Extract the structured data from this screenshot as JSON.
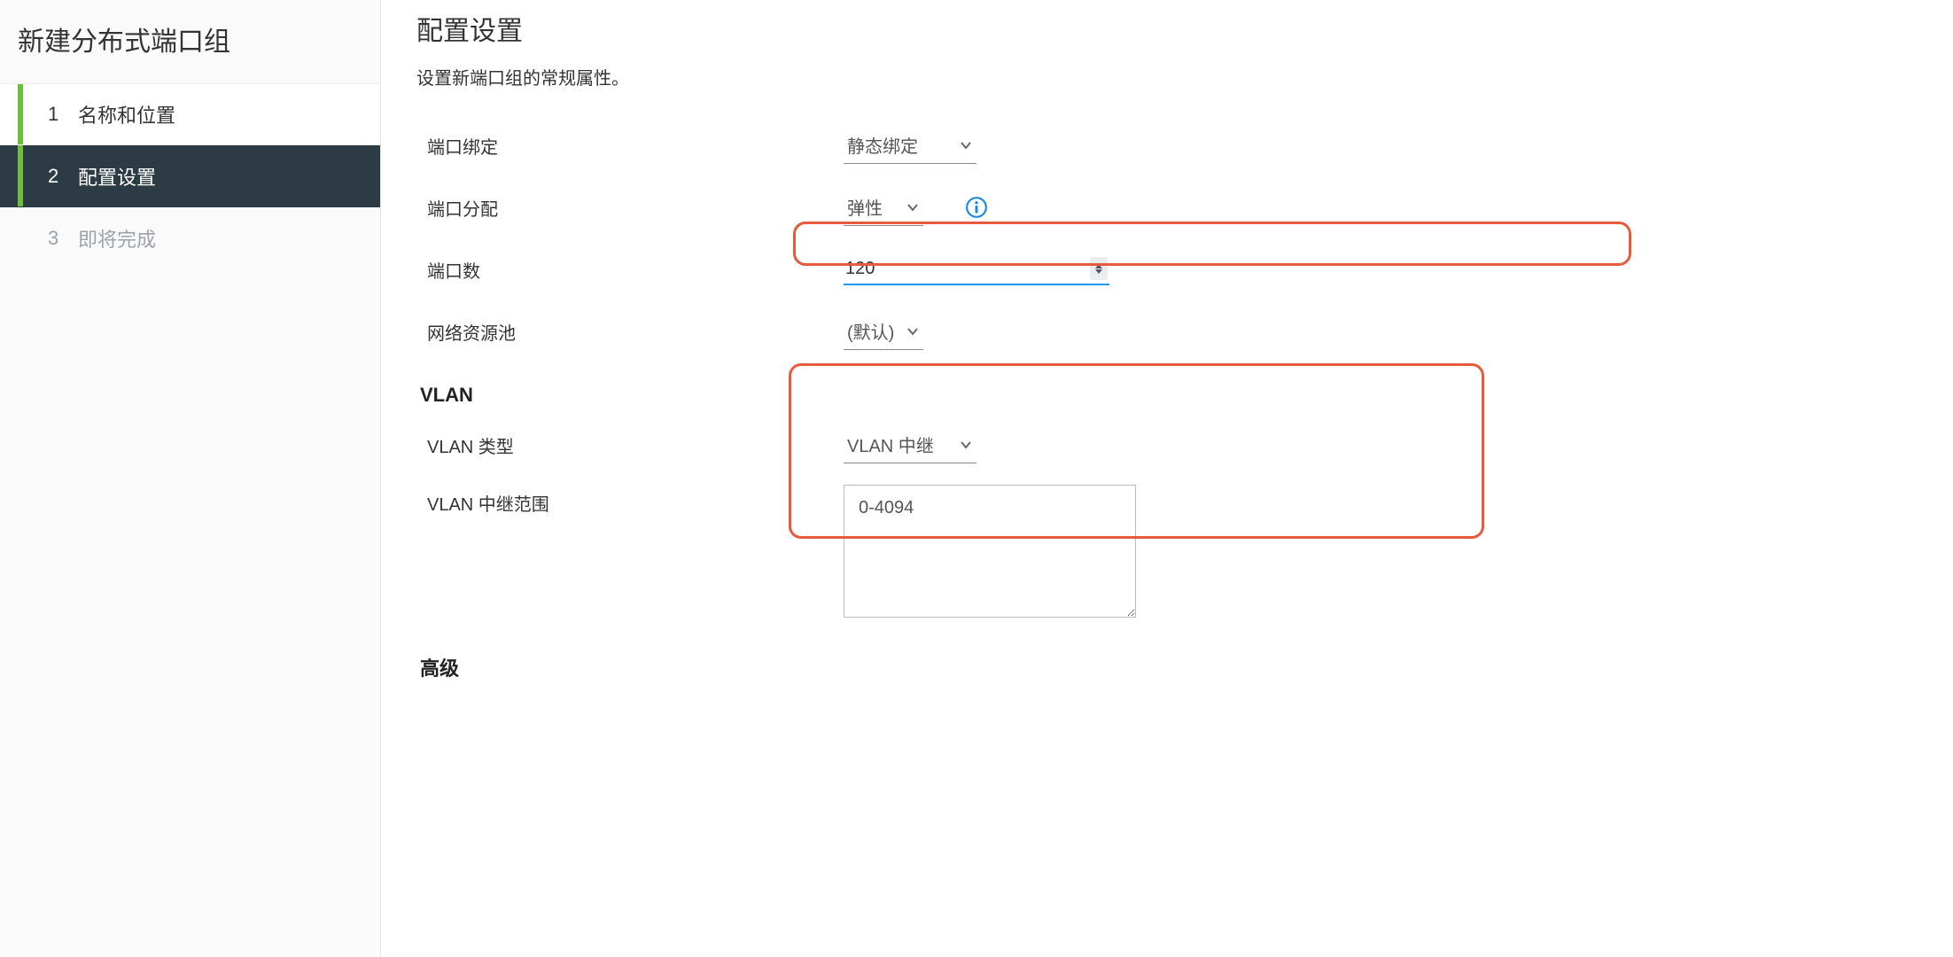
{
  "sidebar": {
    "title": "新建分布式端口组",
    "steps": [
      {
        "num": "1",
        "label": "名称和位置",
        "state": "visited"
      },
      {
        "num": "2",
        "label": "配置设置",
        "state": "active"
      },
      {
        "num": "3",
        "label": "即将完成",
        "state": "disabled"
      }
    ]
  },
  "main": {
    "title": "配置设置",
    "subtitle": "设置新端口组的常规属性。",
    "fields": {
      "port_binding": {
        "label": "端口绑定",
        "value": "静态绑定"
      },
      "port_alloc": {
        "label": "端口分配",
        "value": "弹性"
      },
      "port_count": {
        "label": "端口数",
        "value": "120"
      },
      "resource_pool": {
        "label": "网络资源池",
        "value": "(默认)"
      }
    },
    "vlan": {
      "section": "VLAN",
      "type": {
        "label": "VLAN 类型",
        "value": "VLAN 中继"
      },
      "range": {
        "label": "VLAN 中继范围",
        "value": "0-4094"
      }
    },
    "advanced_section": "高级"
  }
}
